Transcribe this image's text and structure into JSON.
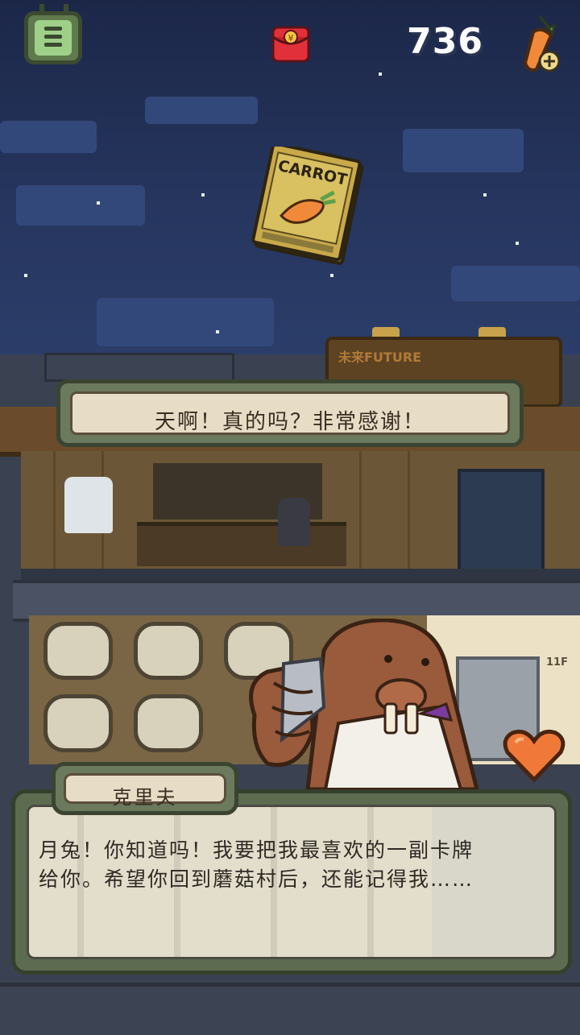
{
  "hud": {
    "coin_count": "736",
    "menu_icon": "menu-list-icon",
    "red_packet_icon": "red-envelope-icon",
    "red_packet_symbol": "¥",
    "carrot_icon": "carrot-add-icon"
  },
  "scene": {
    "card_pack_label": "CARROT",
    "shop_sign": "未来FUTURE",
    "floor_label": "11F"
  },
  "bubble": {
    "text": "天啊！真的吗？非常感谢！"
  },
  "dialog": {
    "speaker": "克里夫",
    "lines": [
      "月兔！你知道吗！我要把我最喜欢的一副卡牌",
      "给你。希望你回到蘑菇村后，还能记得我……"
    ]
  },
  "colors": {
    "sky": "#1c2748",
    "panel_green": "#6b7a5c",
    "panel_paper": "#e7dcc6",
    "heart": "#f0793a"
  }
}
